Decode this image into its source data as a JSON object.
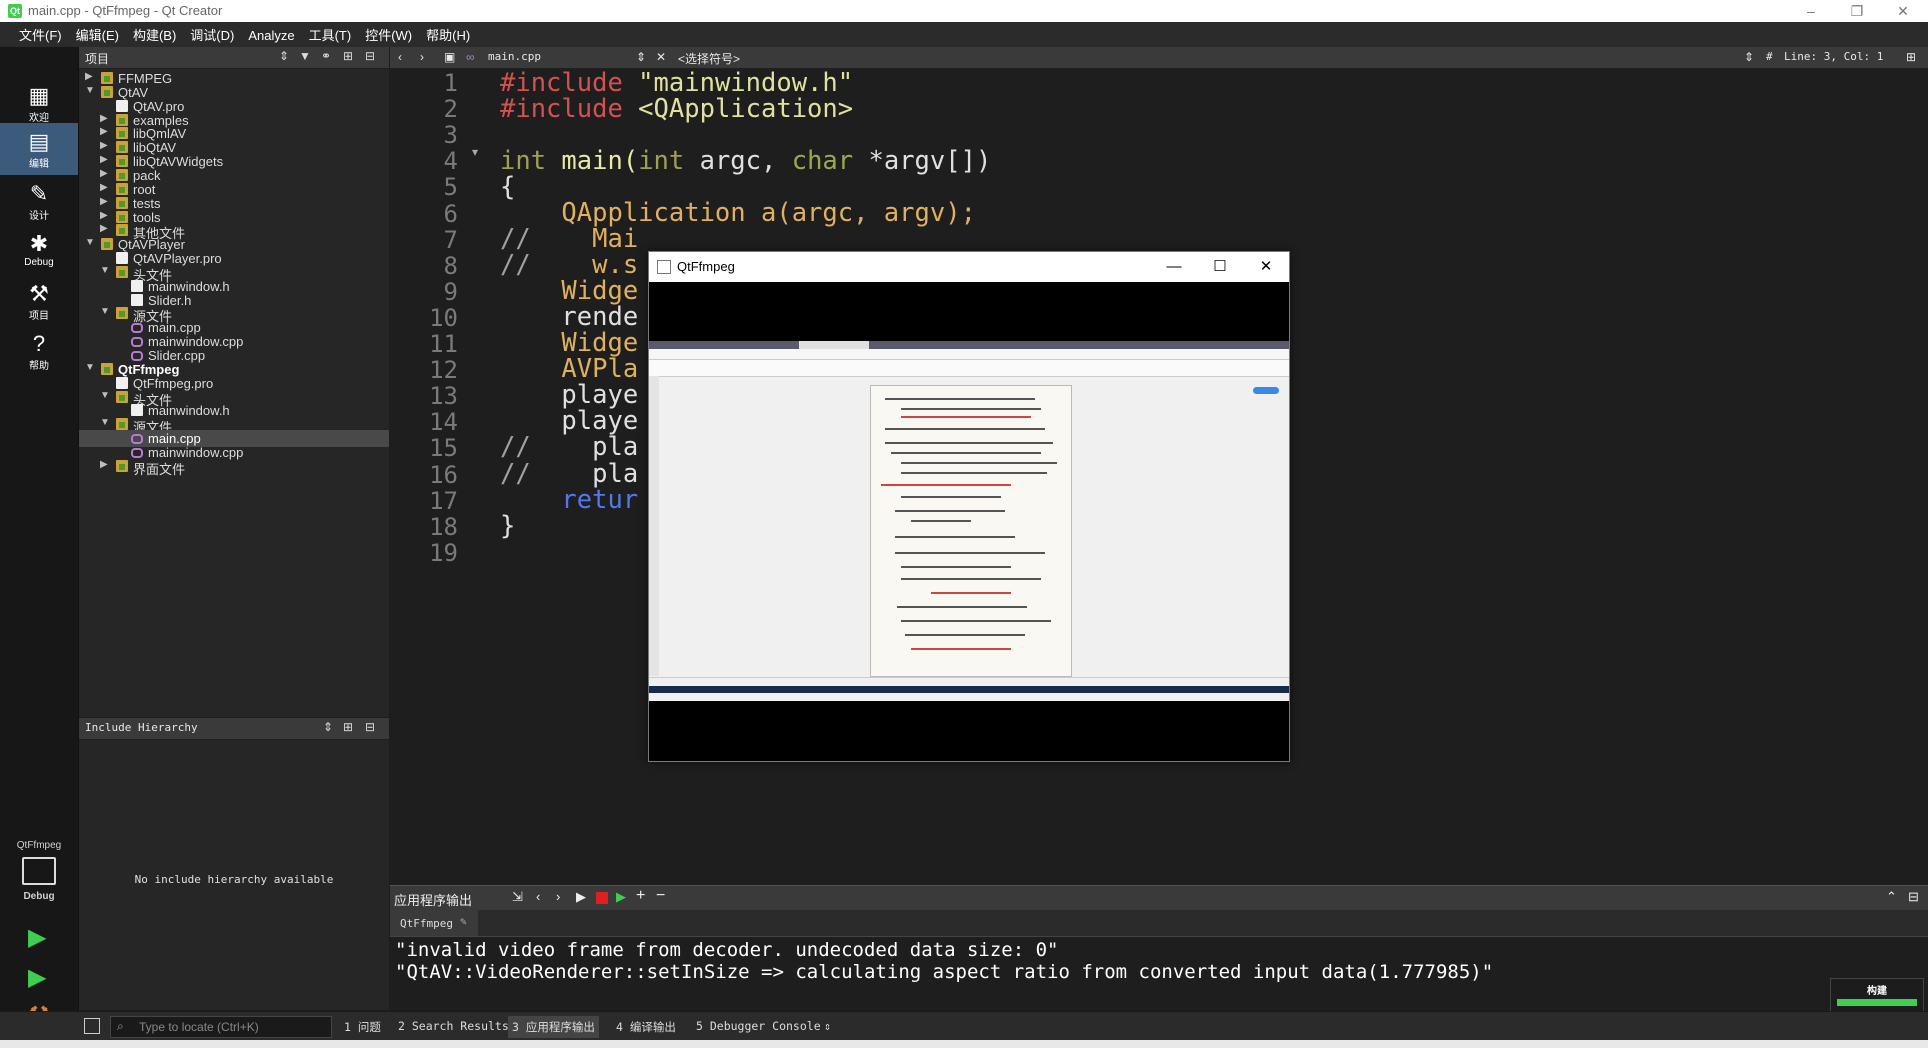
{
  "window": {
    "title": "main.cpp - QtFfmpeg - Qt Creator",
    "logo": "Qt",
    "minimize": "–",
    "restore": "❐",
    "close": "✕"
  },
  "menu": [
    "文件(F)",
    "编辑(E)",
    "构建(B)",
    "调试(D)",
    "Analyze",
    "工具(T)",
    "控件(W)",
    "帮助(H)"
  ],
  "modes": [
    {
      "label": "欢迎",
      "icon": "grid-icon"
    },
    {
      "label": "编辑",
      "icon": "edit-doc-icon"
    },
    {
      "label": "设计",
      "icon": "pencil-icon"
    },
    {
      "label": "Debug",
      "icon": "bug-icon"
    },
    {
      "label": "项目",
      "icon": "wrench-icon"
    },
    {
      "label": "帮助",
      "icon": "help-icon"
    }
  ],
  "kit": {
    "name": "QtFfmpeg",
    "mode": "Debug"
  },
  "project_pane": {
    "title": "项目",
    "tree": [
      {
        "label": "FFMPEG",
        "depth": 0,
        "type": "folder",
        "arrow": "▶"
      },
      {
        "label": "QtAV",
        "depth": 0,
        "type": "folder",
        "arrow": "▼"
      },
      {
        "label": "QtAV.pro",
        "depth": 1,
        "type": "file",
        "arrow": ""
      },
      {
        "label": "examples",
        "depth": 1,
        "type": "folder",
        "arrow": "▶"
      },
      {
        "label": "libQmlAV",
        "depth": 1,
        "type": "folder",
        "arrow": "▶"
      },
      {
        "label": "libQtAV",
        "depth": 1,
        "type": "folder",
        "arrow": "▶"
      },
      {
        "label": "libQtAVWidgets",
        "depth": 1,
        "type": "folder",
        "arrow": "▶"
      },
      {
        "label": "pack",
        "depth": 1,
        "type": "folder",
        "arrow": "▶"
      },
      {
        "label": "root",
        "depth": 1,
        "type": "folder",
        "arrow": "▶"
      },
      {
        "label": "tests",
        "depth": 1,
        "type": "folder",
        "arrow": "▶"
      },
      {
        "label": "tools",
        "depth": 1,
        "type": "folder",
        "arrow": "▶"
      },
      {
        "label": "其他文件",
        "depth": 1,
        "type": "folder",
        "arrow": "▶"
      },
      {
        "label": "QtAVPlayer",
        "depth": 0,
        "type": "folder",
        "arrow": "▼"
      },
      {
        "label": "QtAVPlayer.pro",
        "depth": 1,
        "type": "file",
        "arrow": ""
      },
      {
        "label": "头文件",
        "depth": 1,
        "type": "folder",
        "arrow": "▼"
      },
      {
        "label": "mainwindow.h",
        "depth": 2,
        "type": "file",
        "arrow": ""
      },
      {
        "label": "Slider.h",
        "depth": 2,
        "type": "file",
        "arrow": ""
      },
      {
        "label": "源文件",
        "depth": 1,
        "type": "folder",
        "arrow": "▼"
      },
      {
        "label": "main.cpp",
        "depth": 2,
        "type": "cpp",
        "arrow": ""
      },
      {
        "label": "mainwindow.cpp",
        "depth": 2,
        "type": "cpp",
        "arrow": ""
      },
      {
        "label": "Slider.cpp",
        "depth": 2,
        "type": "cpp",
        "arrow": ""
      },
      {
        "label": "QtFfmpeg",
        "depth": 0,
        "type": "folder",
        "arrow": "▼",
        "bold": true
      },
      {
        "label": "QtFfmpeg.pro",
        "depth": 1,
        "type": "file",
        "arrow": ""
      },
      {
        "label": "头文件",
        "depth": 1,
        "type": "folder",
        "arrow": "▼"
      },
      {
        "label": "mainwindow.h",
        "depth": 2,
        "type": "file",
        "arrow": ""
      },
      {
        "label": "源文件",
        "depth": 1,
        "type": "folder",
        "arrow": "▼"
      },
      {
        "label": "main.cpp",
        "depth": 2,
        "type": "cpp",
        "arrow": "",
        "selected": true
      },
      {
        "label": "mainwindow.cpp",
        "depth": 2,
        "type": "cpp",
        "arrow": ""
      },
      {
        "label": "界面文件",
        "depth": 1,
        "type": "folder",
        "arrow": "▶"
      }
    ]
  },
  "include_pane": {
    "title": "Include Hierarchy",
    "message": "No include hierarchy available"
  },
  "editor_toolbar": {
    "file": "main.cpp",
    "symbol": "<选择符号>",
    "position": "Line: 3, Col: 1",
    "hash": "#"
  },
  "code_lines": [
    "1",
    "2",
    "3",
    "4",
    "5",
    "6",
    "7",
    "8",
    "9",
    "10",
    "11",
    "12",
    "13",
    "14",
    "15",
    "16",
    "17",
    "18",
    "19"
  ],
  "code": {
    "l1a": "#include",
    "l1b": " \"mainwindow.h\"",
    "l2a": "#include",
    "l2b": " <QApplication>",
    "l4a": "int",
    "l4b": " main(",
    "l4c": "int",
    "l4d": " argc, ",
    "l4e": "char",
    "l4f": " *argv[])",
    "l5": "{",
    "l6": "    QApplication a(argc, argv);",
    "l7a": "//",
    "l7b": "    Mai",
    "l8a": "//",
    "l8b": "    w.s",
    "l9": "    Widge",
    "l10": "    rende",
    "l11": "    Widge",
    "l12": "    AVPla",
    "l13": "    playe",
    "l14": "    playe",
    "l15a": "//",
    "l15b": "    pla",
    "l16a": "//",
    "l16b": "    pla",
    "l17": "    retur",
    "l18": "}"
  },
  "output": {
    "title": "应用程序输出",
    "tab": "QtFfmpeg",
    "lines": [
      "\"invalid video frame from decoder. undecoded data size: 0\"",
      "\"QtAV::VideoRenderer::setInSize => calculating aspect ratio from converted input data(1.777985)\""
    ]
  },
  "statusbar": {
    "locate_placeholder": "Type to locate (Ctrl+K)",
    "tabs": [
      "1 问题",
      "2 Search Results",
      "3 应用程序输出",
      "4 编译输出",
      "5 Debugger Console"
    ],
    "build_label": "构建"
  },
  "ffwindow": {
    "title": "QtFfmpeg",
    "minimize": "—",
    "maximize": "☐",
    "close": "✕"
  },
  "colors": {
    "accent": "#3c5a7c",
    "run_green": "#41cd52",
    "stop_red": "#e02020"
  }
}
